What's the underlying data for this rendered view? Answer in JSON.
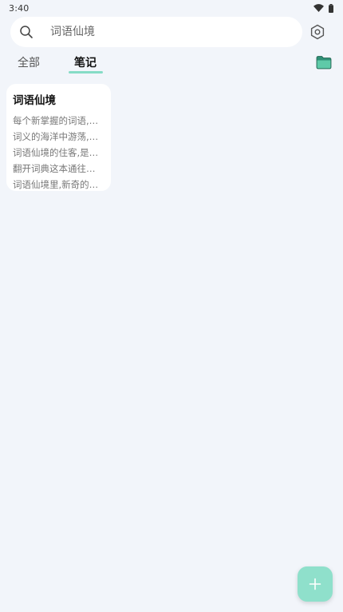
{
  "status_bar": {
    "time": "3:40",
    "icons": [
      "wifi-icon",
      "battery-icon"
    ]
  },
  "search": {
    "placeholder": "词语仙境",
    "icon": "search-icon"
  },
  "header": {
    "settings_icon": "settings-icon"
  },
  "tabs": [
    {
      "label": "全部",
      "selected": false
    },
    {
      "label": "笔记",
      "selected": true
    }
  ],
  "folder": {
    "icon": "folder-icon",
    "color": "#5fcaa8"
  },
  "notes": [
    {
      "title": "词语仙境",
      "lines": [
        "每个新掌握的词语,…",
        "词义的海洋中游荡,…",
        "词语仙境的住客,是…",
        "翻开词典这本通往…",
        "词语仙境里,新奇的…"
      ]
    }
  ],
  "fab": {
    "icon": "plus-icon",
    "color": "#8fe0cb"
  },
  "colors": {
    "background": "#f2f5fa",
    "accent": "#86dcc6"
  }
}
